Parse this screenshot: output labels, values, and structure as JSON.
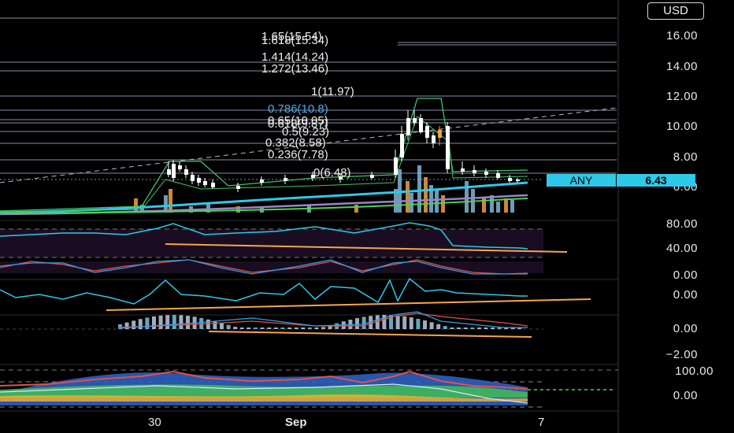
{
  "currency_button": "USD",
  "symbol_tag": {
    "name": "ANY",
    "price": "6.43"
  },
  "price_axis": [
    "16.00",
    "14.00",
    "12.00",
    "10.00",
    "8.00",
    "6.00"
  ],
  "fib_levels": [
    {
      "label": "1.65(15.54)"
    },
    {
      "label": "1.618(15.34)"
    },
    {
      "label": "1.414(14.24)"
    },
    {
      "label": "1.272(13.46)"
    },
    {
      "label": "1(11.97)"
    },
    {
      "label": "0.786(10.8)"
    },
    {
      "label": "0.65(10.05)"
    },
    {
      "label": "0.618(9.87)"
    },
    {
      "label": "0.5(9.23)"
    },
    {
      "label": "0.382(8.58)"
    },
    {
      "label": "0.236(7.78)"
    },
    {
      "label": "0(6.48)"
    }
  ],
  "rsi_axis": [
    "80.00",
    "40.00"
  ],
  "stoch_axis": [
    "0.00"
  ],
  "mom_axis": [
    "0.00"
  ],
  "macd_axis": [
    "0.00",
    "−2.00"
  ],
  "osc_axis": [
    "100.00",
    "0.00"
  ],
  "time_axis": [
    "30",
    "Sep",
    "7"
  ],
  "colors": {
    "candle_up": "#ffffff",
    "candle_down": "#f0a13c",
    "accent_cyan": "#2ec9e8",
    "trend_orange": "#f7a54b",
    "ma_green": "#49d64f",
    "ma_purple": "#9a84c8"
  }
}
